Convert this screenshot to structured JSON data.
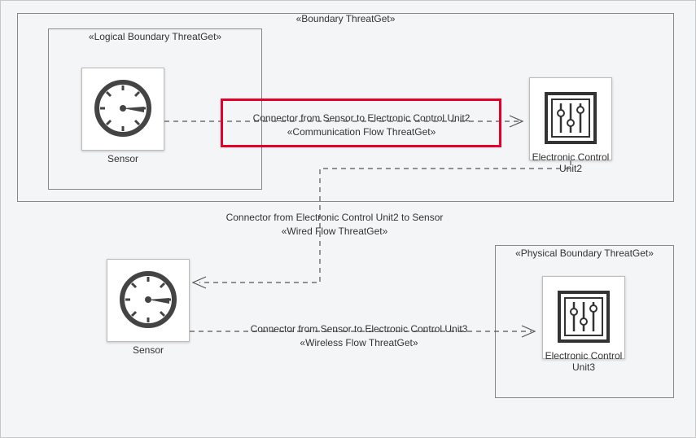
{
  "outer_boundary_label": "«Boundary ThreatGet»",
  "logical_boundary_label": "«Logical Boundary ThreatGet»",
  "physical_boundary_label": "«Physical Boundary ThreatGet»",
  "sensor1_label": "Sensor",
  "sensor2_label": "Sensor",
  "ecu2_label": "Electronic Control Unit2",
  "ecu3_label": "Electronic Control Unit3",
  "connector1_line1": "Connector from Sensor to Electronic Control Unit2",
  "connector1_line2": "«Communication Flow ThreatGet»",
  "connector2_line1": "Connector from Electronic Control Unit2 to Sensor",
  "connector2_line2": "«Wired Flow ThreatGet»",
  "connector3_line1": "Connector from Sensor to Electronic Control Unit3",
  "connector3_line2": "«Wireless Flow ThreatGet»",
  "icons": {
    "sensor": "gauge-icon",
    "ecu": "control-panel-icon"
  },
  "highlight_target": "connector1"
}
